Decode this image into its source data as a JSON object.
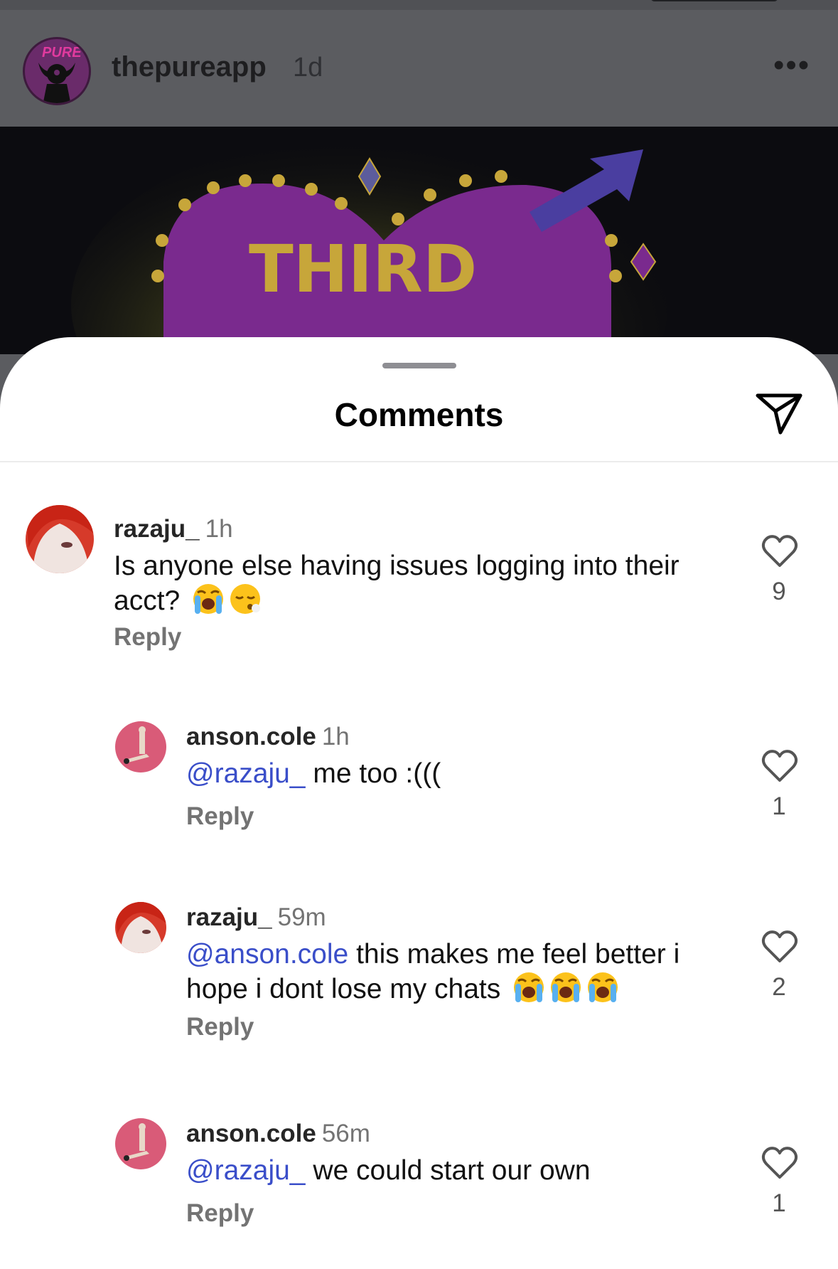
{
  "post": {
    "username": "thepureapp",
    "time": "1d",
    "more_label": "•••",
    "avatar_logo_text": "PURE",
    "image_text": "THIRD"
  },
  "sheet": {
    "title": "Comments"
  },
  "colors": {
    "mention": "#3a4ec9",
    "sheet_bg": "#ffffff",
    "dim_bg": "#5b5c60"
  },
  "comments": [
    {
      "username": "razaju_",
      "time": "1h",
      "mention": "",
      "text": "Is anyone else having issues logging into their acct?",
      "emojis": [
        "loudly-crying-face",
        "face-exhaling"
      ],
      "reply_label": "Reply",
      "likes": "9"
    },
    {
      "username": "anson.cole",
      "time": "1h",
      "mention": "@razaju_",
      "text": " me too :(((",
      "emojis": [],
      "reply_label": "Reply",
      "likes": "1"
    },
    {
      "username": "razaju_",
      "time": "59m",
      "mention": "@anson.cole",
      "text": " this makes me feel better i hope i dont lose my chats",
      "emojis": [
        "loudly-crying-face",
        "loudly-crying-face",
        "loudly-crying-face"
      ],
      "reply_label": "Reply",
      "likes": "2"
    },
    {
      "username": "anson.cole",
      "time": "56m",
      "mention": "@razaju_",
      "text": " we could start our own",
      "emojis": [],
      "reply_label": "Reply",
      "likes": "1"
    }
  ]
}
